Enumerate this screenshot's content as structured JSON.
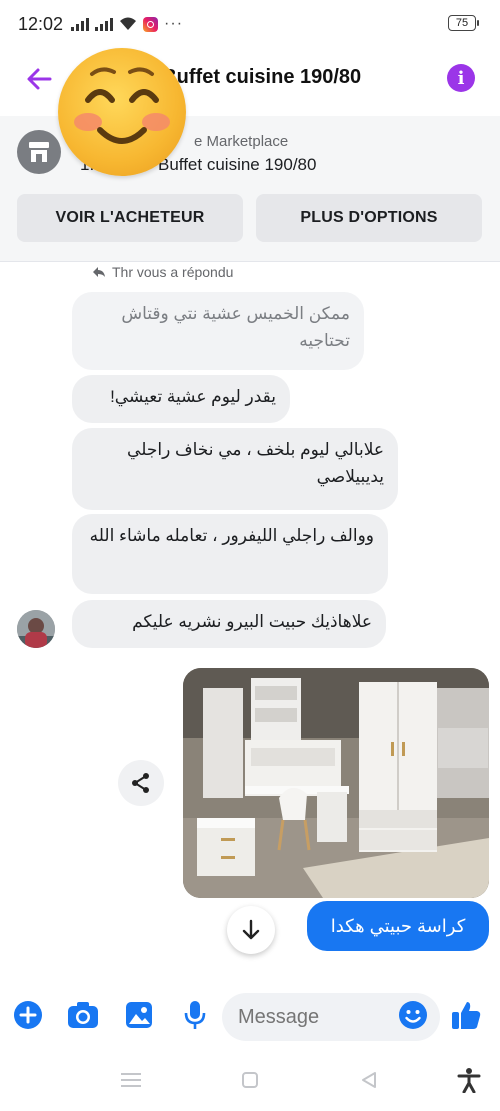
{
  "status_bar": {
    "time": "12:02",
    "more": "···",
    "battery": "75"
  },
  "header": {
    "title": "· Buffet cuisine 190/80",
    "back_icon": "arrow-left-icon",
    "info_icon": "info-icon",
    "accent_color": "#9b35e8"
  },
  "marketplace": {
    "label": "e Marketplace",
    "prefix": "1:",
    "item_title": "Buffet cuisine 190/80",
    "buttons": {
      "view_buyer": "VOIR L'ACHETEUR",
      "more_options": "PLUS D'OPTIONS"
    }
  },
  "chat": {
    "reply_hint": "Thr vous a répondu",
    "quoted_message": "ممكن الخميس عشية نتي وقتاش تحتاجيه",
    "messages": [
      "يقدر ليوم عشية تعيشي!",
      "علابالي ليوم بلخف ، مي نخاف راجلي يديبيلاصي",
      "ووالف راجلي الليفرور ، تعامله ماشاء الله",
      "علاهاذيك حبيت البيرو نشريه عليكم"
    ],
    "sent_message": "كراسة حبيتي هكدا",
    "sent_color": "#1877f2"
  },
  "composer": {
    "placeholder": "Message",
    "icons": [
      "plus-icon",
      "camera-icon",
      "image-icon",
      "microphone-icon",
      "emoji-icon",
      "thumbs-up-icon"
    ]
  },
  "navbar": {
    "icons": [
      "menu-icon",
      "home-square-icon",
      "back-triangle-icon",
      "accessibility-icon"
    ]
  }
}
